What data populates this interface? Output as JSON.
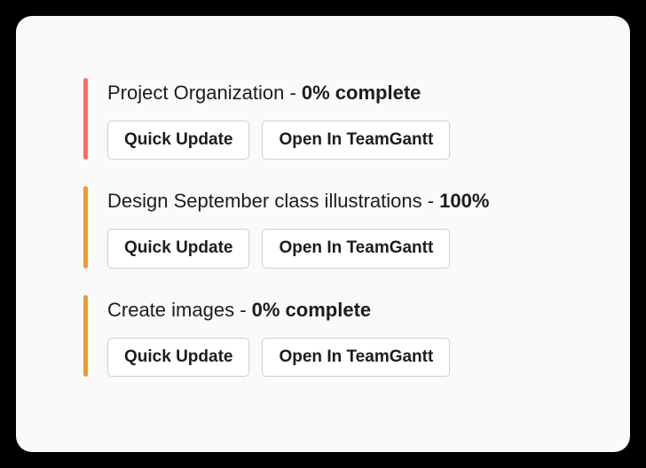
{
  "tasks": [
    {
      "name": "Project Organization",
      "separator": " - ",
      "completion": "0% complete",
      "accent_color": "#ff6e5a",
      "actions": {
        "quick_update": "Quick Update",
        "open_app": "Open In TeamGantt"
      }
    },
    {
      "name": "Design September class illustrations",
      "separator": " - ",
      "completion": "100%",
      "accent_color": "#f09a2f",
      "actions": {
        "quick_update": "Quick Update",
        "open_app": "Open In TeamGantt"
      }
    },
    {
      "name": "Create images",
      "separator": " - ",
      "completion": "0% complete",
      "accent_color": "#f09a2f",
      "actions": {
        "quick_update": "Quick Update",
        "open_app": "Open In TeamGantt"
      }
    }
  ]
}
